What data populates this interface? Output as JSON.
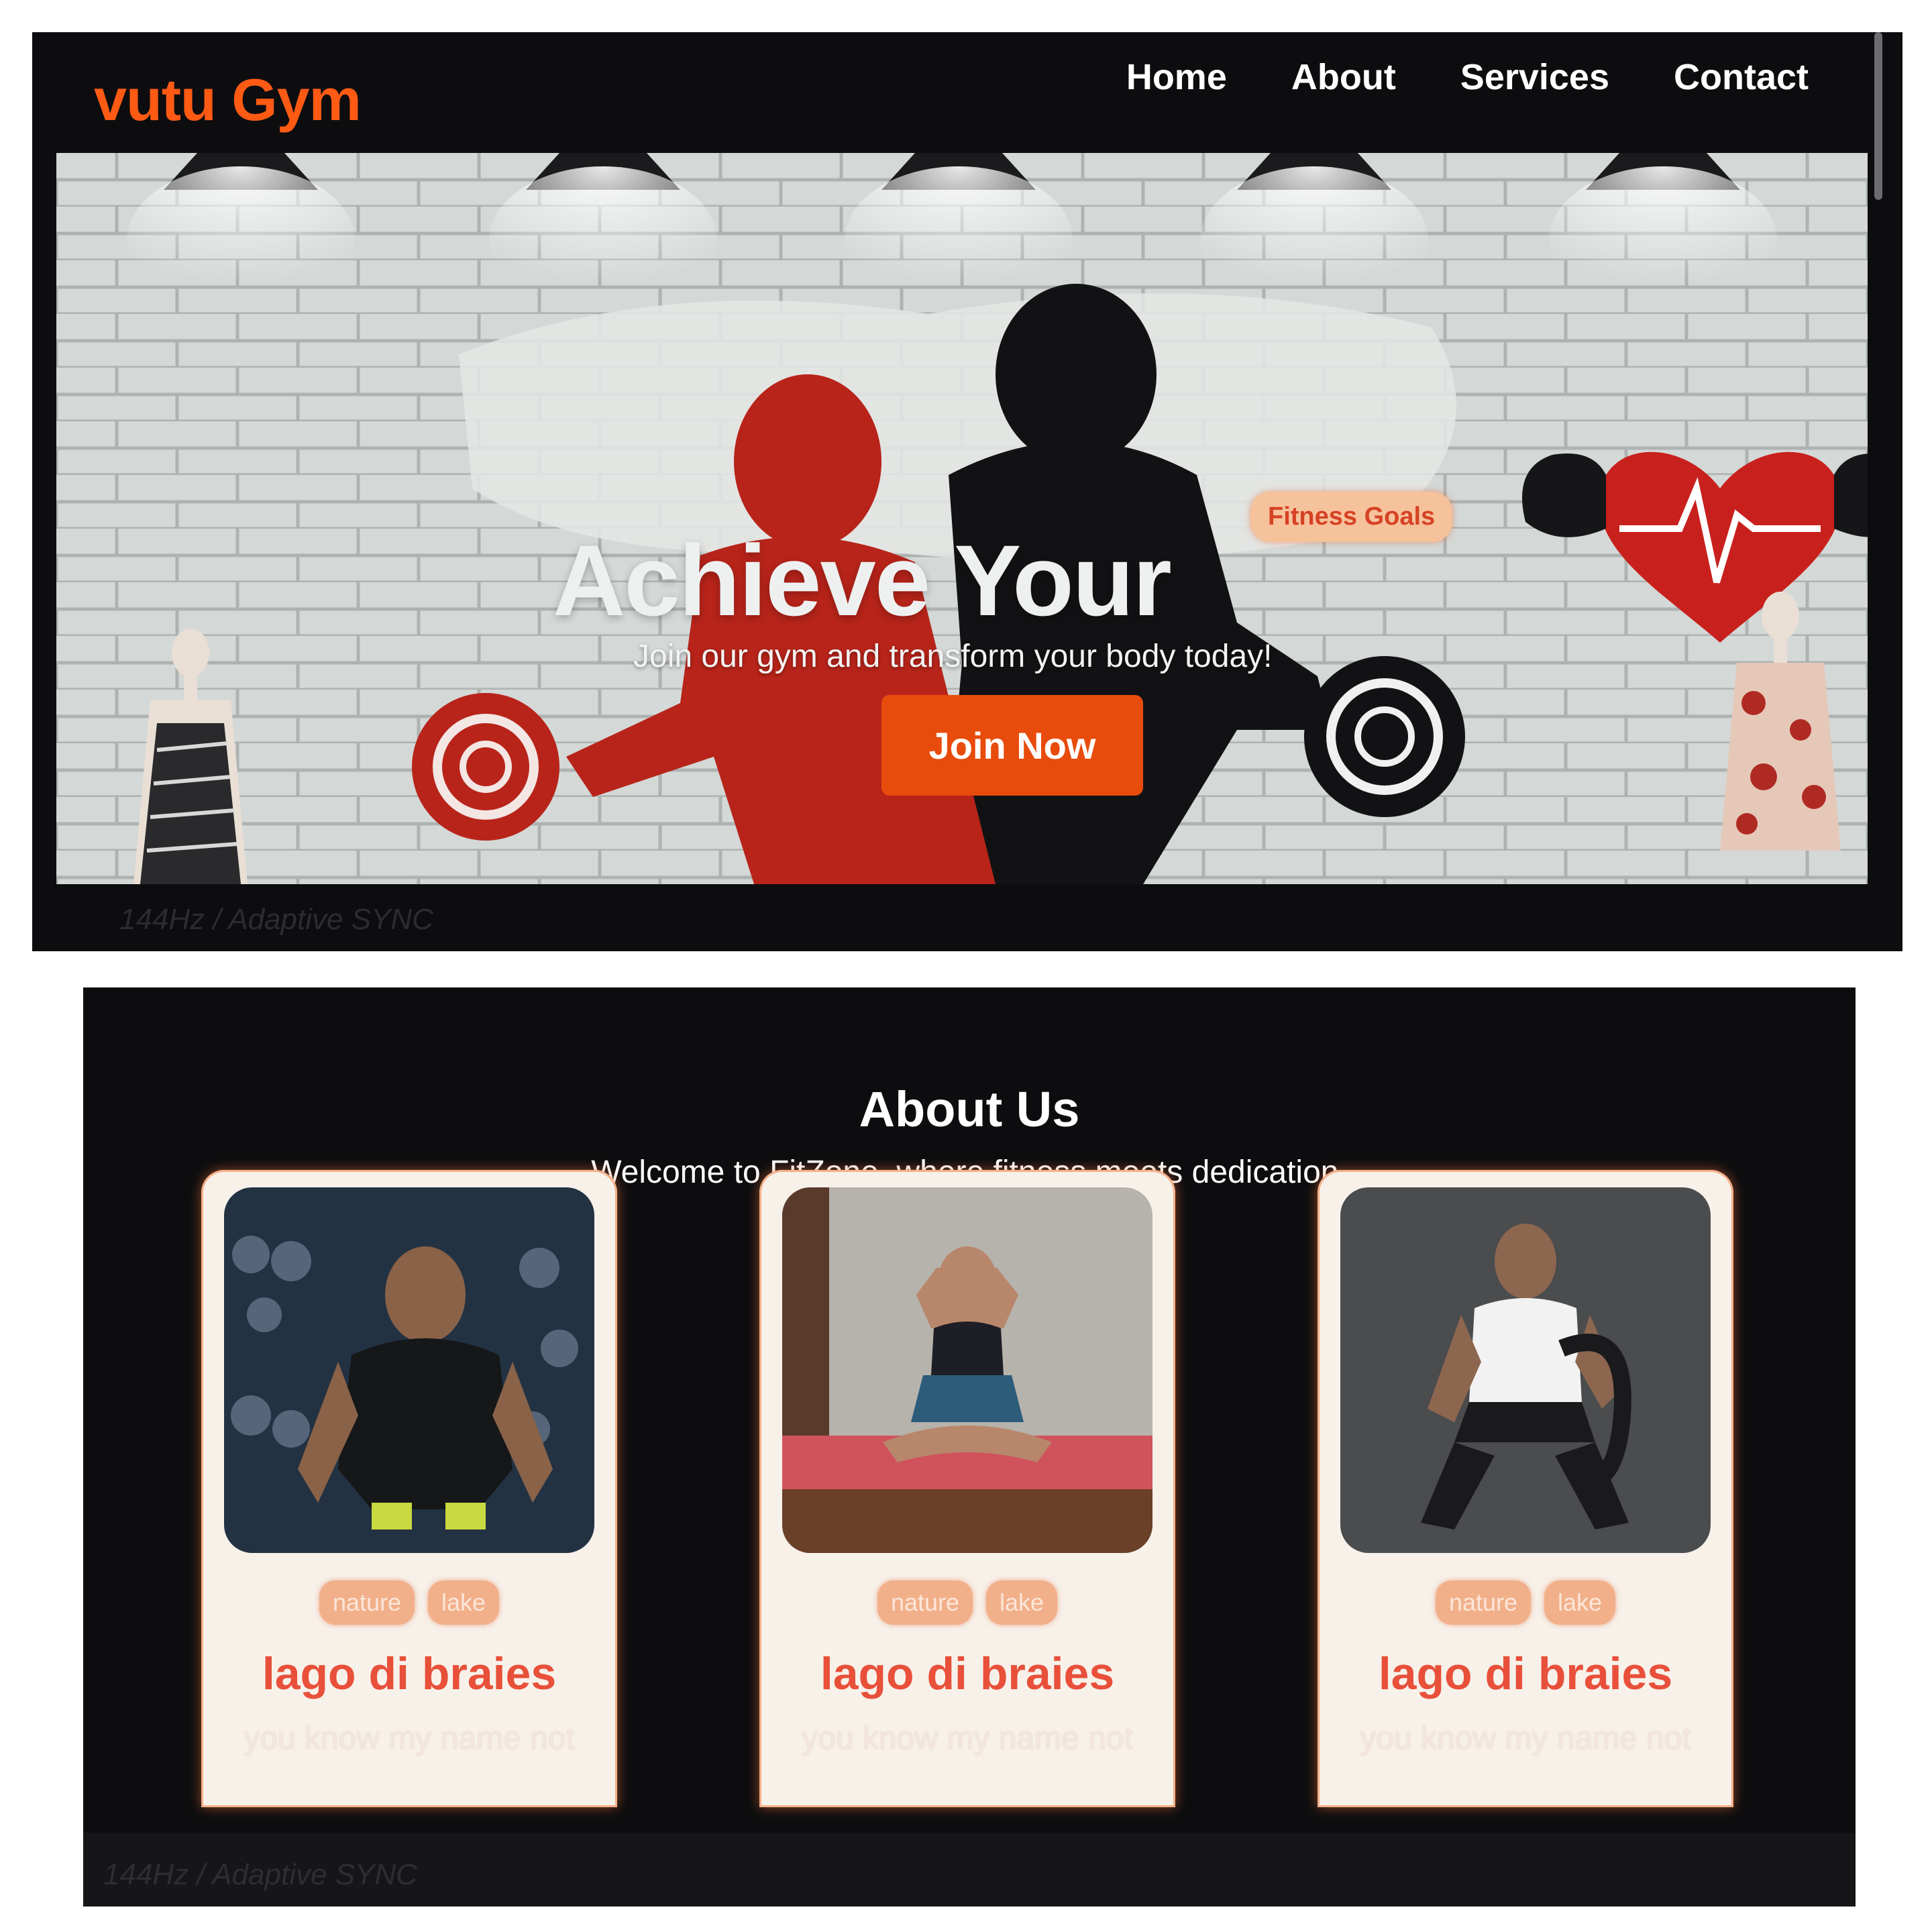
{
  "header": {
    "brand": "vutu Gym",
    "nav": [
      "Home",
      "About",
      "Services",
      "Contact"
    ]
  },
  "hero": {
    "title": "Achieve Your",
    "badge": "Fitness Goals",
    "subtitle": "Join our gym and transform your body today!",
    "cta": "Join Now"
  },
  "bezel": {
    "label": "144Hz / Adaptive SYNC"
  },
  "about": {
    "title": "About Us",
    "subtitle": "Welcome to FitZone, where fitness meets dedication.",
    "cards": [
      {
        "tags": [
          "nature",
          "lake"
        ],
        "title": "lago di braies",
        "desc": "you know my name not"
      },
      {
        "tags": [
          "nature",
          "lake"
        ],
        "title": "lago di braies",
        "desc": "you know my name not"
      },
      {
        "tags": [
          "nature",
          "lake"
        ],
        "title": "lago di braies",
        "desc": "you know my name not"
      }
    ]
  },
  "colors": {
    "brand": "#ff5a14",
    "cta": "#e84c0c",
    "card_title": "#e8503a",
    "tag_bg": "#f2b08a",
    "screen_bg": "#0d0d0f"
  }
}
